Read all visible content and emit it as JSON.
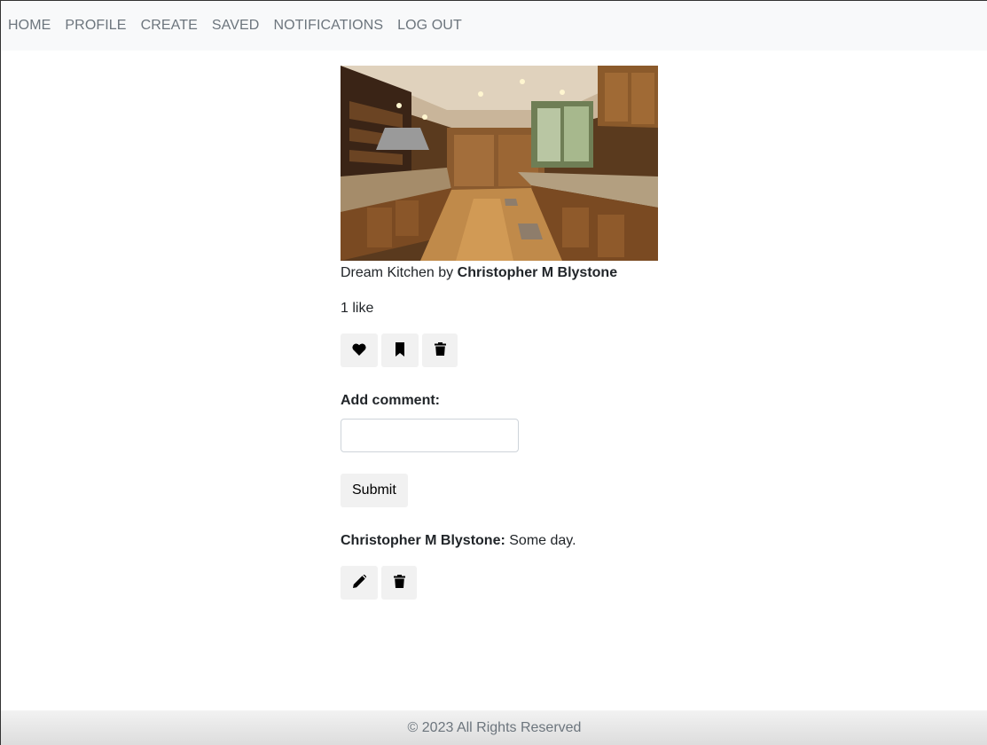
{
  "nav": {
    "items": [
      {
        "label": "HOME"
      },
      {
        "label": "PROFILE"
      },
      {
        "label": "CREATE"
      },
      {
        "label": "SAVED"
      },
      {
        "label": "NOTIFICATIONS"
      },
      {
        "label": "LOG OUT"
      }
    ]
  },
  "post": {
    "title": "Dream Kitchen",
    "by_text": "by",
    "author": "Christopher M Blystone",
    "likes_text": "1 like",
    "actions": {
      "like_icon": "heart-icon",
      "save_icon": "bookmark-icon",
      "delete_icon": "trash-icon"
    }
  },
  "comment_form": {
    "label": "Add comment:",
    "input_value": "",
    "submit_label": "Submit"
  },
  "comments": [
    {
      "author": "Christopher M Blystone:",
      "text": "Some day.",
      "edit_icon": "pencil-icon",
      "delete_icon": "trash-icon"
    }
  ],
  "footer": {
    "text": "© 2023 All Rights Reserved"
  },
  "colors": {
    "nav_bg": "#f8f9fa",
    "nav_text": "#6c757d",
    "button_bg": "#f1f1f1",
    "footer_text": "#6c757d"
  }
}
